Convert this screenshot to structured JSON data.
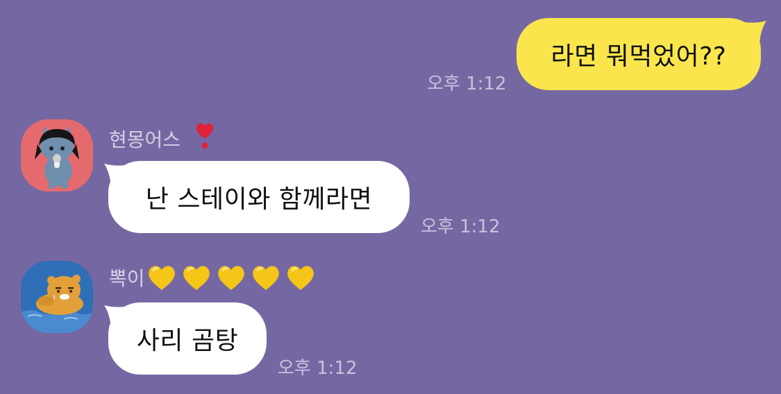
{
  "messages": [
    {
      "id": "m1",
      "side": "right",
      "text": "라면 뭐먹었어??",
      "time": "오후 1:12"
    },
    {
      "id": "m2",
      "side": "left",
      "sender": "현몽어스",
      "sender_emoji": "heart-exclamation",
      "text": "난 스테이와 함께라면",
      "time": "오후 1:12"
    },
    {
      "id": "m3",
      "side": "left",
      "sender": "뽁이",
      "sender_emoji": "yellow-heart x5",
      "text": "사리 곰탕",
      "time": "오후 1:12"
    }
  ],
  "colors": {
    "background": "#7568A2",
    "my_bubble": "#FAE64C",
    "their_bubble": "#FFFFFF",
    "time_text": "#C9C2DE",
    "name_text": "#D6D0E6",
    "avatar1_bg": "#E56A6E",
    "avatar2_bg": "#2F6FB7",
    "red_heart": "#E0213A",
    "yellow_heart": "#F5C518"
  },
  "icons": {
    "avatar1": "kakao-neo-character-icon",
    "avatar2": "kakao-ryan-floating-icon",
    "heart_red": "heart-exclamation-icon",
    "heart_yellow": "yellow-heart-icon"
  }
}
